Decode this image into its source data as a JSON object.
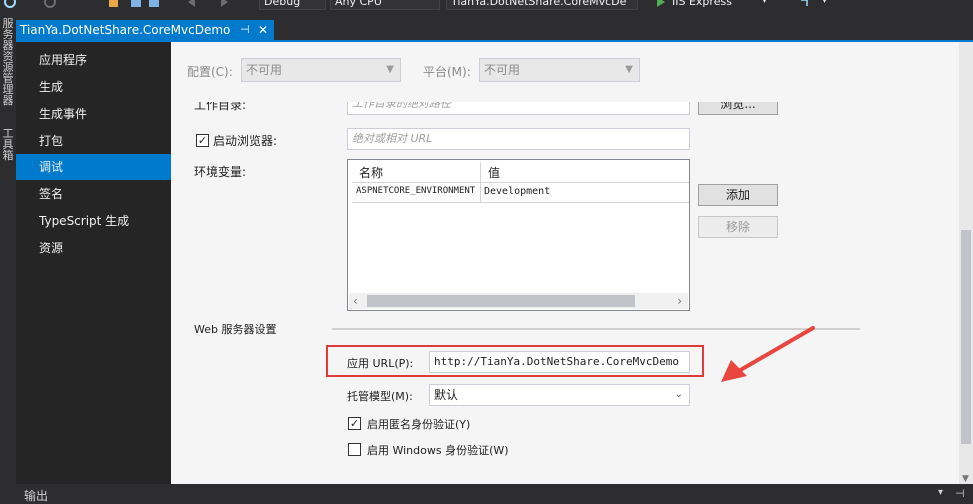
{
  "toolbar": {
    "config_value": "Debug",
    "platform_value": "Any CPU",
    "project_value": "TianYa.DotNetShare.CoreMvcDe",
    "run_label": "IIS Express"
  },
  "left_strip": {
    "tabs": [
      "服务器资源管理器",
      "工具箱"
    ]
  },
  "doc_tab": {
    "title": "TianYa.DotNetShare.CoreMvcDemo",
    "pin_glyph": "⊣",
    "close_glyph": "✕"
  },
  "nav": {
    "items": [
      {
        "label": "应用程序",
        "selected": false
      },
      {
        "label": "生成",
        "selected": false
      },
      {
        "label": "生成事件",
        "selected": false
      },
      {
        "label": "打包",
        "selected": false
      },
      {
        "label": "调试",
        "selected": true
      },
      {
        "label": "签名",
        "selected": false
      },
      {
        "label": "TypeScript 生成",
        "selected": false
      },
      {
        "label": "资源",
        "selected": false
      }
    ]
  },
  "config": {
    "config_label": "配置(C):",
    "config_value": "不可用",
    "platform_label": "平台(M):",
    "platform_value": "不可用"
  },
  "workdir": {
    "label": "工作目录:",
    "placeholder": "工作目录的绝对路径",
    "browse_label": "浏览..."
  },
  "launch_browser": {
    "checked": true,
    "check_glyph": "✓",
    "label": "启动浏览器:",
    "placeholder": "绝对或相对 URL"
  },
  "env": {
    "label": "环境变量:",
    "columns": [
      "名称",
      "值"
    ],
    "rows": [
      {
        "name": "ASPNETCORE_ENVIRONMENT",
        "value": "Development"
      }
    ],
    "add_label": "添加",
    "remove_label": "移除",
    "scroll_left": "‹",
    "scroll_right": "›"
  },
  "web_server": {
    "section_label": "Web 服务器设置",
    "app_url_label": "应用 URL(P):",
    "app_url_value": "http://TianYa.DotNetShare.CoreMvcDemo",
    "hosting_label": "托管模型(M):",
    "hosting_value": "默认",
    "anon_auth_label": "启用匿名身份验证(Y)",
    "anon_auth_checked": true,
    "windows_auth_label": "启用 Windows 身份验证(W)",
    "windows_auth_checked": false
  },
  "bottom": {
    "output_label": "输出"
  },
  "colors": {
    "accent": "#007acc",
    "highlight_box": "#e03b3b",
    "arrow": "#e8463f"
  }
}
